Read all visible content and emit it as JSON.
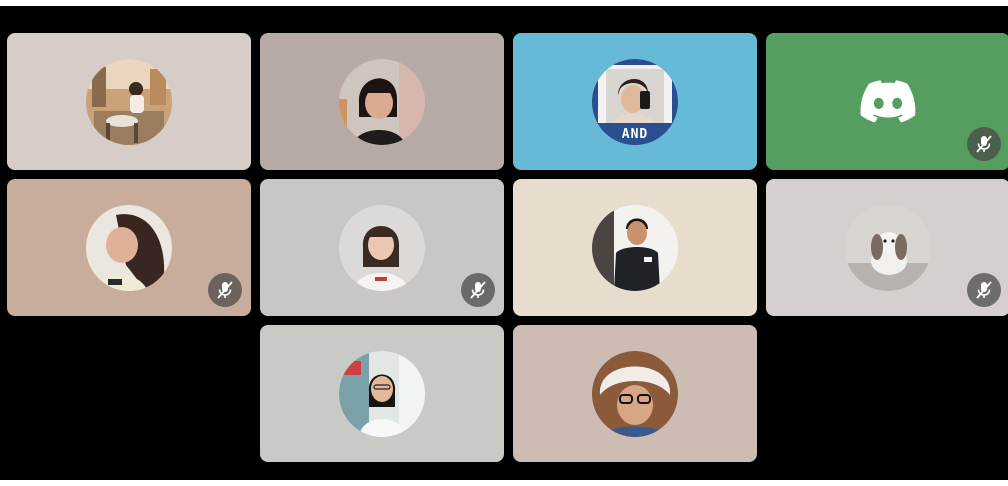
{
  "call": {
    "participants": [
      {
        "id": "p1",
        "bg": "#d6ccc8",
        "avatar": "photo-woman-cafe",
        "muted": false
      },
      {
        "id": "p2",
        "bg": "#b7a9a6",
        "avatar": "photo-woman-bob-hair",
        "muted": false
      },
      {
        "id": "p3",
        "bg": "#67b9d8",
        "avatar": "photo-man-mirror-selfie",
        "muted": false,
        "avatar_text": "AND"
      },
      {
        "id": "p4",
        "bg": "#569e5f",
        "avatar": "discord-default-logo",
        "muted": true
      },
      {
        "id": "p5",
        "bg": "#c8ad9c",
        "avatar": "photo-woman-long-hair",
        "muted": true
      },
      {
        "id": "p6",
        "bg": "#c9c7c5",
        "avatar": "photo-woman-white-shirt",
        "muted": true
      },
      {
        "id": "p7",
        "bg": "#e6ddcf",
        "avatar": "photo-man-dark-shirt",
        "muted": false
      },
      {
        "id": "p8",
        "bg": "#d5d0cd",
        "avatar": "photo-rabbit",
        "muted": true
      },
      {
        "id": "p9",
        "bg": "#c7cac5",
        "avatar": "photo-woman-glasses",
        "muted": false
      },
      {
        "id": "p10",
        "bg": "#cdbcb3",
        "avatar": "photo-man-fur-hat",
        "muted": false
      }
    ],
    "mute_icon": "microphone-muted-icon",
    "accent_colors": {
      "mute_badge": "#4a4a4a",
      "stage": "#000000"
    }
  }
}
